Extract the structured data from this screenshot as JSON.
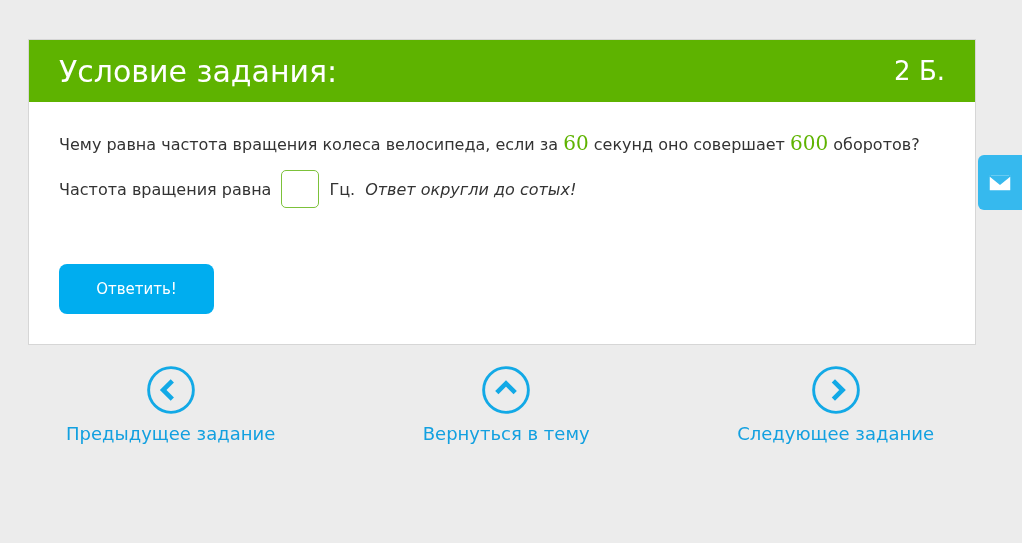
{
  "task": {
    "title": "Условие задания:",
    "points": "2 Б.",
    "question": [
      {
        "kind": "text",
        "text": "Чему равна частота вращения колеса велосипеда, если за "
      },
      {
        "kind": "number",
        "text": "60"
      },
      {
        "kind": "text",
        "text": " секунд оно совершает "
      },
      {
        "kind": "number",
        "text": "600"
      },
      {
        "kind": "text",
        "text": " оборотов?"
      }
    ],
    "answer_prefix": "Частота вращения равна",
    "answer_unit": "Гц.",
    "answer_hint": "Ответ округли до сотых!",
    "submit": "Ответить!"
  },
  "nav": [
    {
      "kind": "prev",
      "label": "Предыдущее задание"
    },
    {
      "kind": "up",
      "label": "Вернуться в тему"
    },
    {
      "kind": "next",
      "label": "Следующее задание"
    }
  ]
}
